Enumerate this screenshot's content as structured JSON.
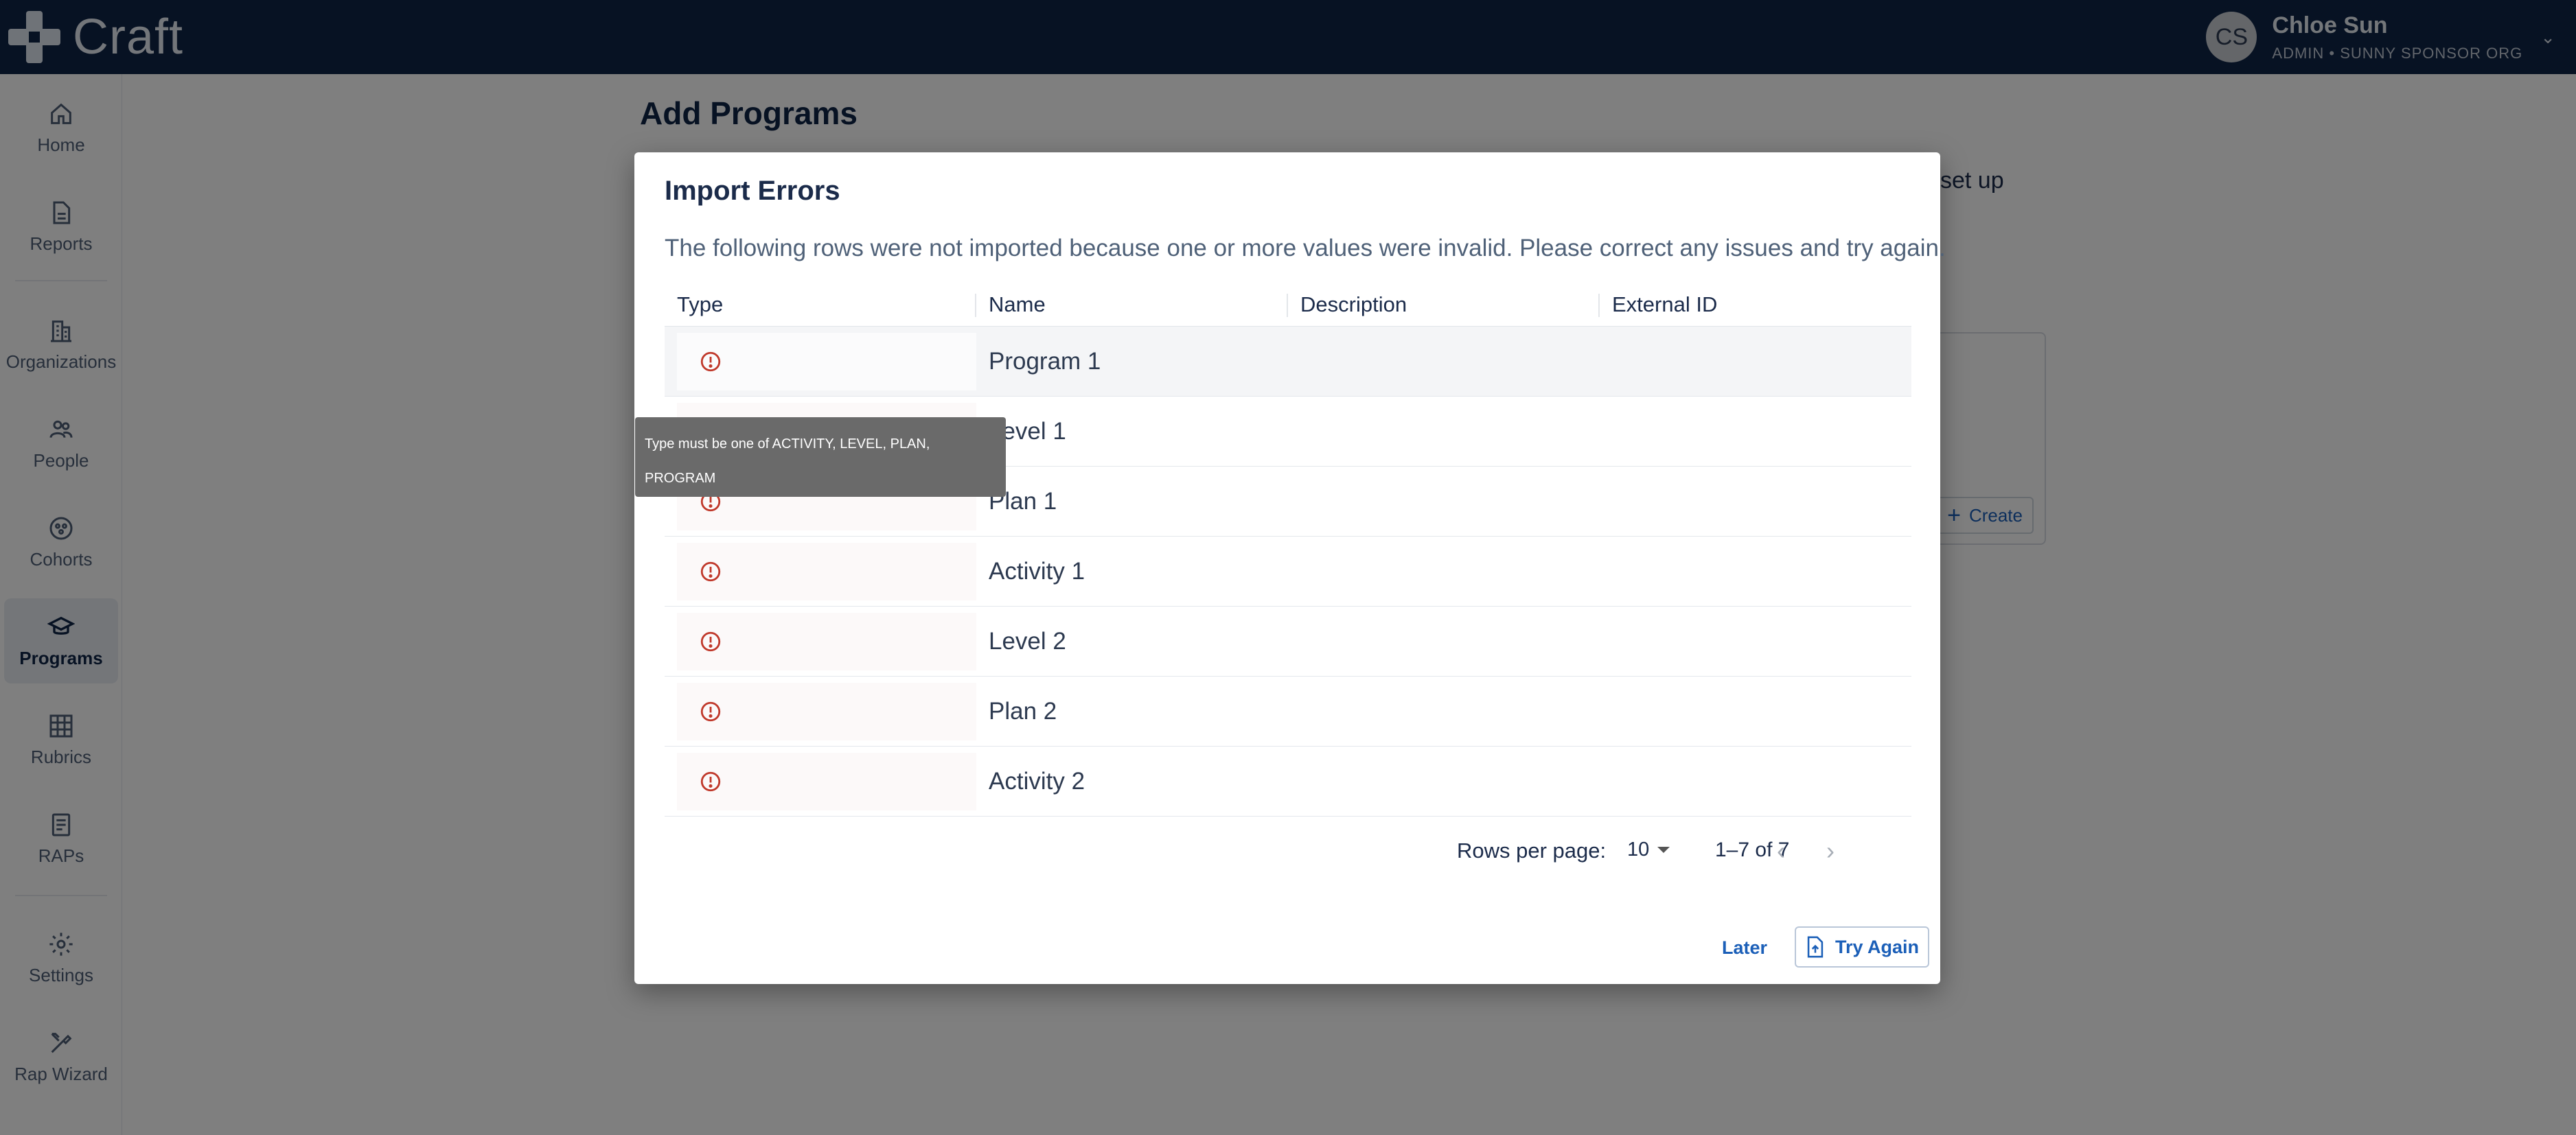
{
  "app": {
    "name": "Craft"
  },
  "user": {
    "initials": "CS",
    "name": "Chloe Sun",
    "role": "ADMIN • SUNNY SPONSOR ORG"
  },
  "sidebar": {
    "items": [
      {
        "label": "Home",
        "icon": "home-icon"
      },
      {
        "label": "Reports",
        "icon": "document-icon"
      },
      {
        "label": "Organizations",
        "icon": "building-icon"
      },
      {
        "label": "People",
        "icon": "people-icon"
      },
      {
        "label": "Cohorts",
        "icon": "cohort-icon"
      },
      {
        "label": "Programs",
        "icon": "graduation-cap-icon",
        "active": true
      },
      {
        "label": "Rubrics",
        "icon": "grid-icon"
      },
      {
        "label": "RAPs",
        "icon": "clipboard-icon"
      },
      {
        "label": "Settings",
        "icon": "gear-icon"
      },
      {
        "label": "Rap Wizard",
        "icon": "tools-icon"
      }
    ]
  },
  "page": {
    "title": "Add Programs",
    "snippet": "set up",
    "create_label": "Create"
  },
  "modal": {
    "title": "Import Errors",
    "description": "The following rows were not imported because one or more values were invalid. Please correct any issues and try again.",
    "columns": [
      "Type",
      "Name",
      "Description",
      "External ID"
    ],
    "rows": [
      {
        "name": "Program 1",
        "description": "",
        "external_id": ""
      },
      {
        "name": "Level 1",
        "description": "",
        "external_id": ""
      },
      {
        "name": "Plan 1",
        "description": "",
        "external_id": ""
      },
      {
        "name": "Activity 1",
        "description": "",
        "external_id": ""
      },
      {
        "name": "Level 2",
        "description": "",
        "external_id": ""
      },
      {
        "name": "Plan 2",
        "description": "",
        "external_id": ""
      },
      {
        "name": "Activity 2",
        "description": "",
        "external_id": ""
      }
    ],
    "tooltip": {
      "line1": "Type must be one of ACTIVITY, LEVEL, PLAN,",
      "line2": "PROGRAM"
    },
    "pagination": {
      "rows_per_page_label": "Rows per page:",
      "rows_per_page": "10",
      "range": "1–7 of 7"
    },
    "later_label": "Later",
    "try_again_label": "Try Again"
  },
  "colors": {
    "topbar": "#0f2447",
    "accent": "#1b5fb8",
    "error": "#c0392b"
  }
}
